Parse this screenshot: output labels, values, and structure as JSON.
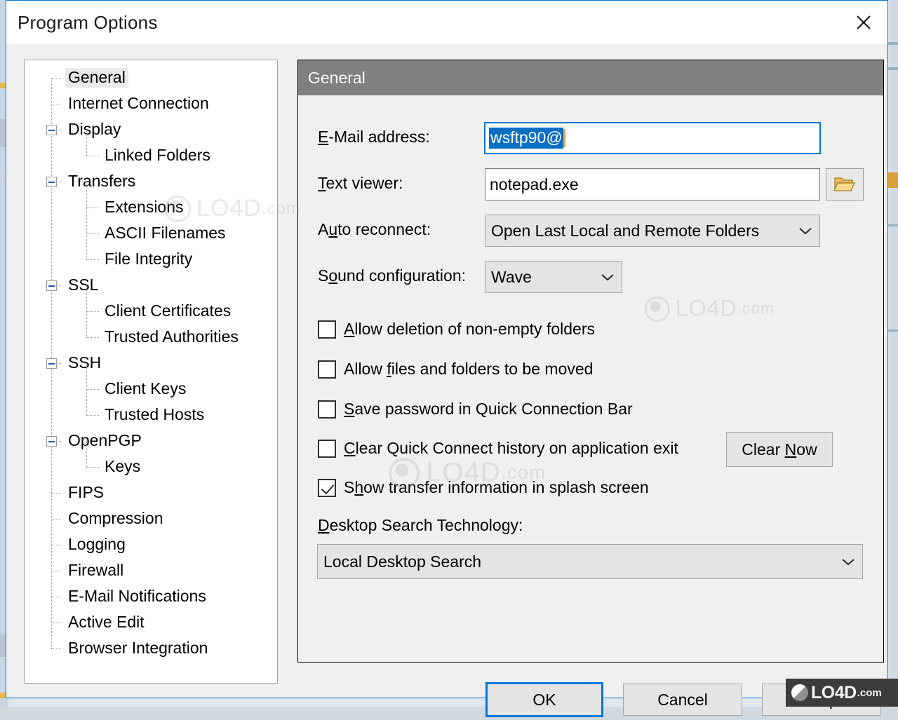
{
  "window": {
    "title": "Program Options",
    "close_label": "×",
    "accent_color": "#0078d7"
  },
  "tree": {
    "items": [
      {
        "label": "General",
        "level": 0,
        "expander": "none",
        "selected": true
      },
      {
        "label": "Internet Connection",
        "level": 0,
        "expander": "none",
        "selected": false
      },
      {
        "label": "Display",
        "level": 0,
        "expander": "collapse",
        "selected": false
      },
      {
        "label": "Linked Folders",
        "level": 1,
        "expander": "none",
        "selected": false
      },
      {
        "label": "Transfers",
        "level": 0,
        "expander": "collapse",
        "selected": false
      },
      {
        "label": "Extensions",
        "level": 1,
        "expander": "none",
        "selected": false
      },
      {
        "label": "ASCII Filenames",
        "level": 1,
        "expander": "none",
        "selected": false
      },
      {
        "label": "File Integrity",
        "level": 1,
        "expander": "none",
        "selected": false
      },
      {
        "label": "SSL",
        "level": 0,
        "expander": "collapse",
        "selected": false
      },
      {
        "label": "Client Certificates",
        "level": 1,
        "expander": "none",
        "selected": false
      },
      {
        "label": "Trusted Authorities",
        "level": 1,
        "expander": "none",
        "selected": false
      },
      {
        "label": "SSH",
        "level": 0,
        "expander": "collapse",
        "selected": false
      },
      {
        "label": "Client Keys",
        "level": 1,
        "expander": "none",
        "selected": false
      },
      {
        "label": "Trusted Hosts",
        "level": 1,
        "expander": "none",
        "selected": false
      },
      {
        "label": "OpenPGP",
        "level": 0,
        "expander": "collapse",
        "selected": false
      },
      {
        "label": "Keys",
        "level": 1,
        "expander": "none",
        "selected": false
      },
      {
        "label": "FIPS",
        "level": 0,
        "expander": "none",
        "selected": false
      },
      {
        "label": "Compression",
        "level": 0,
        "expander": "none",
        "selected": false
      },
      {
        "label": "Logging",
        "level": 0,
        "expander": "none",
        "selected": false
      },
      {
        "label": "Firewall",
        "level": 0,
        "expander": "none",
        "selected": false
      },
      {
        "label": "E-Mail Notifications",
        "level": 0,
        "expander": "none",
        "selected": false
      },
      {
        "label": "Active Edit",
        "level": 0,
        "expander": "none",
        "selected": false
      },
      {
        "label": "Browser Integration",
        "level": 0,
        "expander": "none",
        "selected": false
      }
    ]
  },
  "panel": {
    "header": "General",
    "fields": {
      "email": {
        "label_prefix": "",
        "label_accel": "E",
        "label_suffix": "-Mail address:",
        "value": "wsftp90@",
        "selected": true
      },
      "text_viewer": {
        "label_prefix": "",
        "label_accel": "T",
        "label_suffix": "ext viewer:",
        "value": "notepad.exe",
        "browse_icon": "folder-open-icon"
      },
      "auto_reconnect": {
        "label_prefix": "A",
        "label_accel": "u",
        "label_suffix": "to reconnect:",
        "value": "Open Last Local and Remote Folders"
      },
      "sound_configuration": {
        "label_prefix": "S",
        "label_accel": "o",
        "label_suffix": "und configuration:",
        "value": "Wave"
      },
      "desktop_search": {
        "label_prefix": "",
        "label_accel": "D",
        "label_suffix": "esktop Search Technology:",
        "value": "Local Desktop Search"
      }
    },
    "checkboxes": [
      {
        "prefix": "",
        "accel": "A",
        "suffix": "llow deletion of non-empty folders",
        "checked": false
      },
      {
        "prefix": "Allow ",
        "accel": "f",
        "suffix": "iles and folders to be moved",
        "checked": false
      },
      {
        "prefix": "",
        "accel": "S",
        "suffix": "ave password in Quick Connection Bar",
        "checked": false
      },
      {
        "prefix": "",
        "accel": "C",
        "suffix": "lear Quick Connect history on application exit",
        "checked": false
      },
      {
        "prefix": "S",
        "accel": "h",
        "suffix": "ow transfer information in splash screen",
        "checked": true
      }
    ],
    "clear_now": {
      "prefix": "Clear ",
      "accel": "N",
      "suffix": "ow"
    }
  },
  "buttons": {
    "ok": "OK",
    "cancel": "Cancel",
    "help": "Help"
  },
  "watermarks": {
    "text": "LO4D",
    "suffix": ".com"
  }
}
